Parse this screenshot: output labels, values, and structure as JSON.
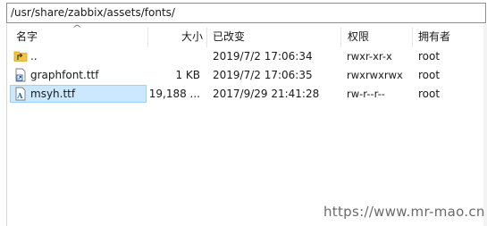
{
  "path": "/usr/share/zabbix/assets/fonts/",
  "columns": {
    "name": "名字",
    "size": "大小",
    "modified": "已改变",
    "permissions": "权限",
    "owner": "拥有者"
  },
  "files": [
    {
      "name": "..",
      "size": "",
      "modified": "2019/7/2 17:06:34",
      "permissions": "rwxr-xr-x",
      "owner": "root",
      "icon": "parent-folder-icon"
    },
    {
      "name": "graphfont.ttf",
      "size": "1 KB",
      "modified": "2019/7/2 17:06:35",
      "permissions": "rwxrwxrwx",
      "owner": "root",
      "icon": "shortcut-file-icon"
    },
    {
      "name": "msyh.ttf",
      "size": "19,188 ...",
      "modified": "2017/9/29 21:41:28",
      "permissions": "rw-r--r--",
      "owner": "root",
      "icon": "font-file-icon",
      "selected": true
    }
  ],
  "watermark": "https://www.mr-mao.cn",
  "colors": {
    "selection_bg": "#cce8ff",
    "selection_border": "#99d1ff",
    "folder": "#f5c242"
  }
}
